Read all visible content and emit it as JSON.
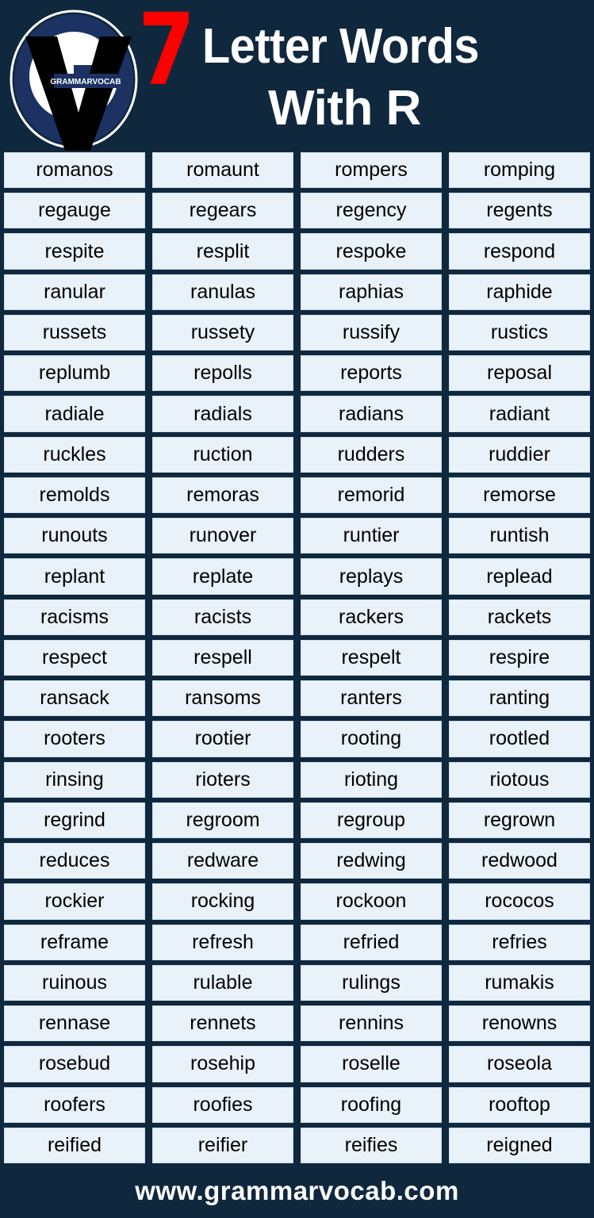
{
  "header": {
    "logo": {
      "brand_text": "GRAMMARVOCAB",
      "mark_letter": "V"
    },
    "number": "7",
    "title_line1": "Letter Words",
    "title_line2": "With R"
  },
  "colors": {
    "background": "#10283d",
    "cell_background": "#e9f2f9",
    "cell_border": "#cfe0ec",
    "number_accent": "#ff0000",
    "title_text": "#ffffff",
    "word_text": "#000000",
    "logo_navy": "#1b3263",
    "logo_white": "#ffffff",
    "logo_black": "#000000"
  },
  "grid": {
    "columns": 4,
    "rows": 25,
    "words": [
      "romanos",
      "romaunt",
      "rompers",
      "romping",
      "regauge",
      "regears",
      "regency",
      "regents",
      "respite",
      "resplit",
      "respoke",
      "respond",
      "ranular",
      "ranulas",
      "raphias",
      "raphide",
      "russets",
      "russety",
      "russify",
      "rustics",
      "replumb",
      "repolls",
      "reports",
      "reposal",
      "radiale",
      "radials",
      "radians",
      "radiant",
      "ruckles",
      "ruction",
      "rudders",
      "ruddier",
      "remolds",
      "remoras",
      "remorid",
      "remorse",
      "runouts",
      "runover",
      "runtier",
      "runtish",
      "replant",
      "replate",
      "replays",
      "replead",
      "racisms",
      "racists",
      "rackers",
      "rackets",
      "respect",
      "respell",
      "respelt",
      "respire",
      "ransack",
      "ransoms",
      "ranters",
      "ranting",
      "rooters",
      "rootier",
      "rooting",
      "rootled",
      "rinsing",
      "rioters",
      "rioting",
      "riotous",
      "regrind",
      "regroom",
      "regroup",
      "regrown",
      "reduces",
      "redware",
      "redwing",
      "redwood",
      "rockier",
      "rocking",
      "rockoon",
      "rococos",
      "reframe",
      "refresh",
      "refried",
      "refries",
      "ruinous",
      "rulable",
      "rulings",
      "rumakis",
      "rennase",
      "rennets",
      "rennins",
      "renowns",
      "rosebud",
      "rosehip",
      "roselle",
      "roseola",
      "roofers",
      "roofies",
      "roofing",
      "rooftop",
      "reified",
      "reifier",
      "reifies",
      "reigned"
    ]
  },
  "footer": {
    "website": "www.grammarvocab.com"
  }
}
